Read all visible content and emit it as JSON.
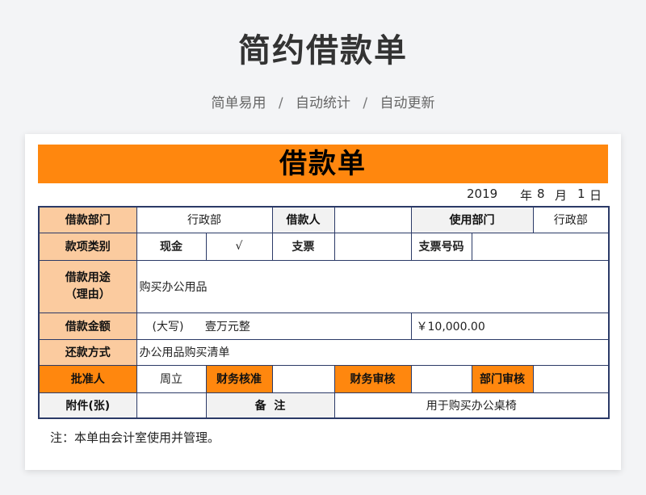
{
  "page": {
    "title": "简约借款单",
    "subtitle_items": [
      "简单易用",
      "自动统计",
      "自动更新"
    ],
    "separator": "/"
  },
  "form": {
    "banner": "借款单",
    "date": {
      "year": "2019",
      "year_unit": "年",
      "month": "8",
      "month_unit": "月",
      "day": "1",
      "day_unit": "日"
    },
    "rows": {
      "dept_label": "借款部门",
      "dept_value": "行政部",
      "borrower_label": "借款人",
      "borrower_value": "",
      "use_dept_label": "使用部门",
      "use_dept_value": "行政部",
      "category_label": "款项类别",
      "cash_label": "现金",
      "cash_value": "√",
      "check_label": "支票",
      "check_value": "",
      "check_no_label": "支票号码",
      "check_no_value": "",
      "purpose_label": "借款用途\n（理由）",
      "purpose_value": "购买办公用品",
      "amount_label": "借款金额",
      "amount_caps_prefix": "(大写)",
      "amount_caps": "壹万元整",
      "amount_num": "￥10,000.00",
      "repay_label": "还款方式",
      "repay_value": "办公用品购买清单",
      "approver_label": "批准人",
      "approver_value": "周立",
      "fin_check_label": "财务核准",
      "fin_check_value": "",
      "fin_audit_label": "财务审核",
      "fin_audit_value": "",
      "dept_audit_label": "部门审核",
      "dept_audit_value": "",
      "attach_label": "附件(张)",
      "attach_value": "",
      "remark_label": "备  注",
      "remark_value": "用于购买办公桌椅"
    },
    "note": "注：本单由会计室使用并管理。"
  },
  "colors": {
    "accent": "#ff870e",
    "label_fill": "#fbcb9f",
    "grey_fill": "#f2f2f2",
    "border": "#2b3a67"
  }
}
